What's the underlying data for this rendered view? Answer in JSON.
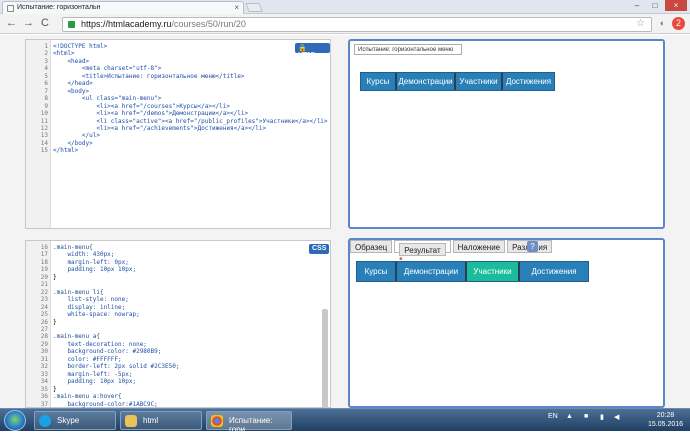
{
  "browser": {
    "tab_title": "Испытание: горизонтальн",
    "tab_close": "×",
    "url_host": "https://htmlacademy.ru",
    "url_path": "/courses/50/run/20",
    "back": "←",
    "forward": "→",
    "reload": "C",
    "star": "☆",
    "window_min": "–",
    "window_max": "□",
    "window_close": "×",
    "ext_badge": "2"
  },
  "html_editor": {
    "badge": "HTML",
    "lines": [
      {
        "n": "1",
        "code": "<!DOCTYPE html>"
      },
      {
        "n": "2",
        "code": "<html>"
      },
      {
        "n": "3",
        "code": "    <head>"
      },
      {
        "n": "4",
        "code": "        <meta charset=\"utf-8\">"
      },
      {
        "n": "5",
        "code": "        <title>Испытание: горизонтальное меню</title>"
      },
      {
        "n": "6",
        "code": "    </head>"
      },
      {
        "n": "7",
        "code": "    <body>"
      },
      {
        "n": "8",
        "code": "        <ul class=\"main-menu\">"
      },
      {
        "n": "9",
        "code": "            <li><a href=\"/courses\">Курсы</a></li>"
      },
      {
        "n": "10",
        "code": "            <li><a href=\"/demos\">Демонстрации</a></li>"
      },
      {
        "n": "11",
        "code": "            <li class=\"active\"><a href=\"/public_profiles\">Участники</a></li>"
      },
      {
        "n": "12",
        "code": "            <li><a href=\"/achievements\">Достижения</a></li>"
      },
      {
        "n": "13",
        "code": "        </ul>"
      },
      {
        "n": "14",
        "code": "    </body>"
      },
      {
        "n": "15",
        "code": "</html>"
      }
    ]
  },
  "css_editor": {
    "badge": "CSS",
    "lines": [
      {
        "n": "16",
        "code": ".main-menu{"
      },
      {
        "n": "17",
        "code": "    width: 430px;"
      },
      {
        "n": "18",
        "code": "    margin-left: 0px;"
      },
      {
        "n": "19",
        "code": "    padding: 10px 10px;"
      },
      {
        "n": "20",
        "code": "}"
      },
      {
        "n": "21",
        "code": ""
      },
      {
        "n": "22",
        "code": ".main-menu li{"
      },
      {
        "n": "23",
        "code": "    list-style: none;"
      },
      {
        "n": "24",
        "code": "    display: inline;"
      },
      {
        "n": "25",
        "code": "    white-space: nowrap;"
      },
      {
        "n": "26",
        "code": "}"
      },
      {
        "n": "27",
        "code": ""
      },
      {
        "n": "28",
        "code": ".main-menu a{"
      },
      {
        "n": "29",
        "code": "    text-decoration: none;"
      },
      {
        "n": "30",
        "code": "    background-color: #2980B9;"
      },
      {
        "n": "31",
        "code": "    color: #FFFFFF;"
      },
      {
        "n": "32",
        "code": "    border-left: 2px solid #2C3E50;"
      },
      {
        "n": "33",
        "code": "    margin-left: -5px;"
      },
      {
        "n": "34",
        "code": "    padding: 10px 10px;"
      },
      {
        "n": "35",
        "code": "}"
      },
      {
        "n": "36",
        "code": ".main-menu a:hover{"
      },
      {
        "n": "37",
        "code": "    background-color:#1ABC9C;"
      }
    ]
  },
  "preview": {
    "page_title": "Испытание: горизонтальное меню",
    "menu": [
      "Курсы",
      "Демонстрации",
      "Участники",
      "Достижения"
    ]
  },
  "result_panel": {
    "tabs": [
      "Образец",
      "Результат",
      "Наложение",
      "Различия"
    ],
    "result_marker": "*",
    "help": "?",
    "menu": [
      "Курсы",
      "Демонстрации",
      "Участники",
      "Достижения"
    ],
    "active_item": "Участники"
  },
  "taskbar": {
    "items": [
      "Skype",
      "html",
      "Испытание: гори..."
    ],
    "lang": "EN",
    "time": "20:28",
    "date": "15.05.2016"
  },
  "colors": {
    "menu_bg": "#2980B9",
    "menu_border": "#2C3E50",
    "menu_active": "#1ABC9C"
  }
}
